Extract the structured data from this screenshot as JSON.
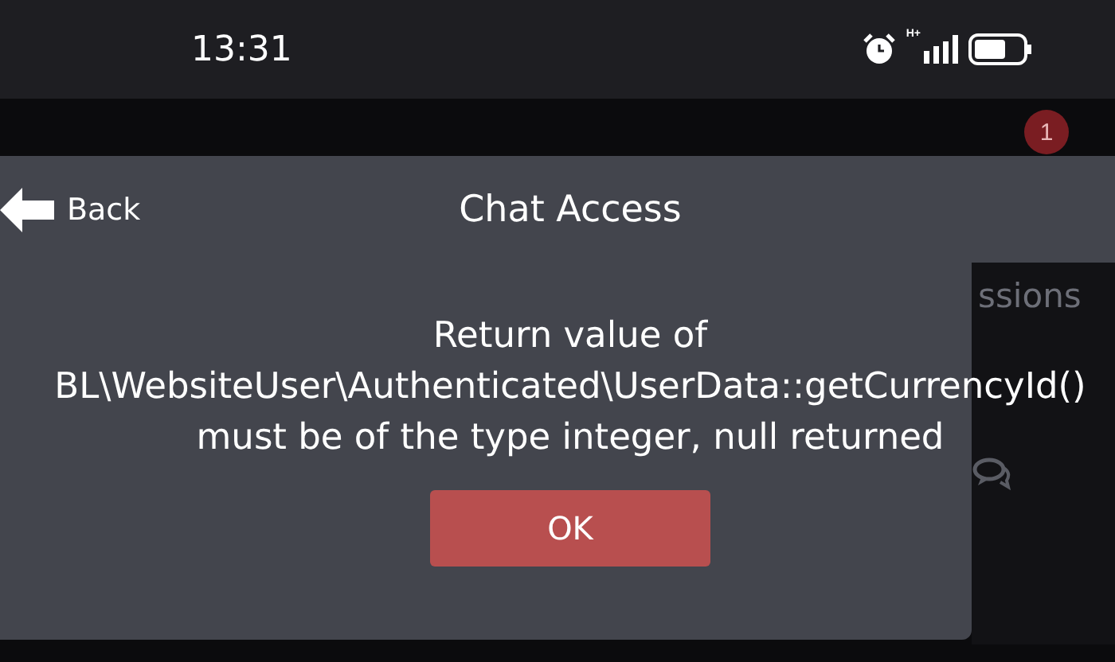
{
  "status_bar": {
    "time": "13:31",
    "network_type": "H+"
  },
  "background": {
    "notification_count": "1",
    "tab_label": "ssions"
  },
  "dialog": {
    "back_label": "Back",
    "title": "Chat Access",
    "message_lines": [
      "Return value of",
      "BL\\WebsiteUser\\Authenticated\\UserData::getCurrencyId()",
      "must be of the type integer, null returned"
    ],
    "button": "OK"
  }
}
